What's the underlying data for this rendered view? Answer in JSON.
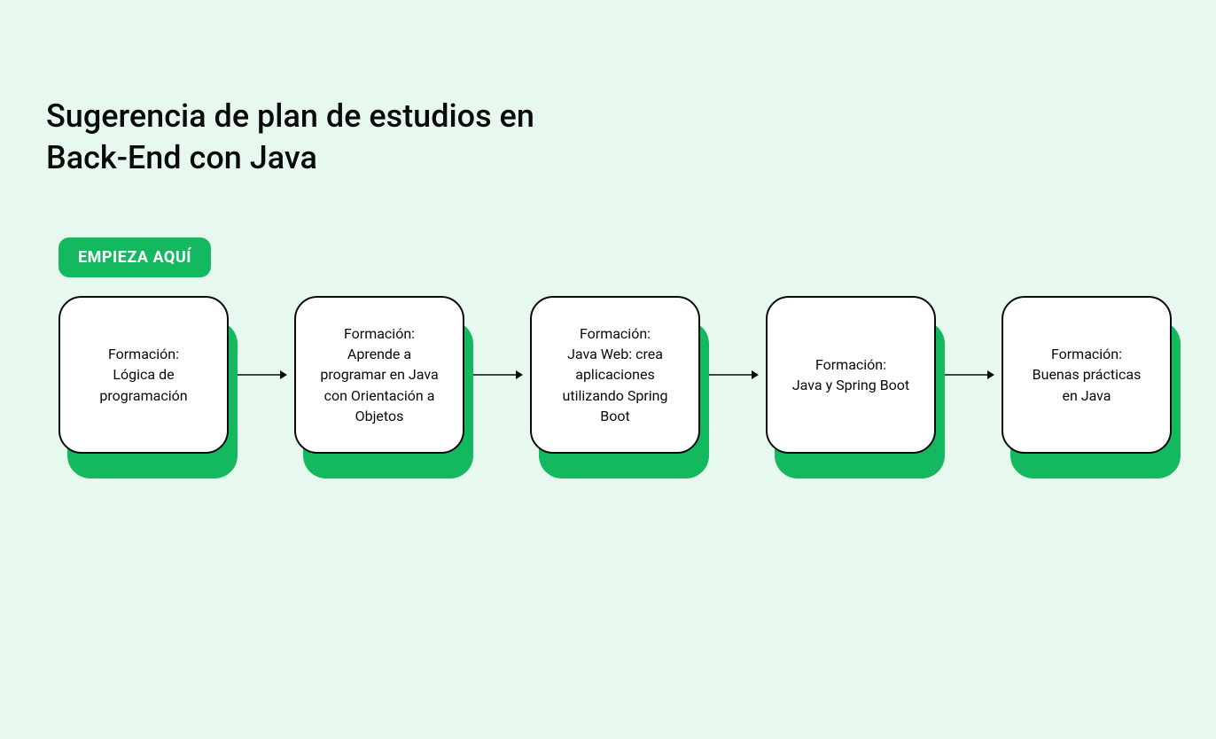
{
  "title": "Sugerencia de plan de estudios en\nBack-End con Java",
  "start_badge": "EMPIEZA AQUÍ",
  "colors": {
    "background": "#e7f9ef",
    "accent": "#14b85f",
    "text": "#0a0a0a",
    "card_bg": "#ffffff"
  },
  "flow": {
    "cards": [
      {
        "text": "Formación:\nLógica de\nprogramación"
      },
      {
        "text": "Formación:\nAprende a\nprogramar en Java\ncon Orientación a\nObjetos"
      },
      {
        "text": "Formación:\nJava Web: crea\naplicaciones\nutilizando Spring\nBoot"
      },
      {
        "text": "Formación:\nJava y Spring Boot"
      },
      {
        "text": "Formación:\nBuenas prácticas\nen Java"
      }
    ]
  }
}
